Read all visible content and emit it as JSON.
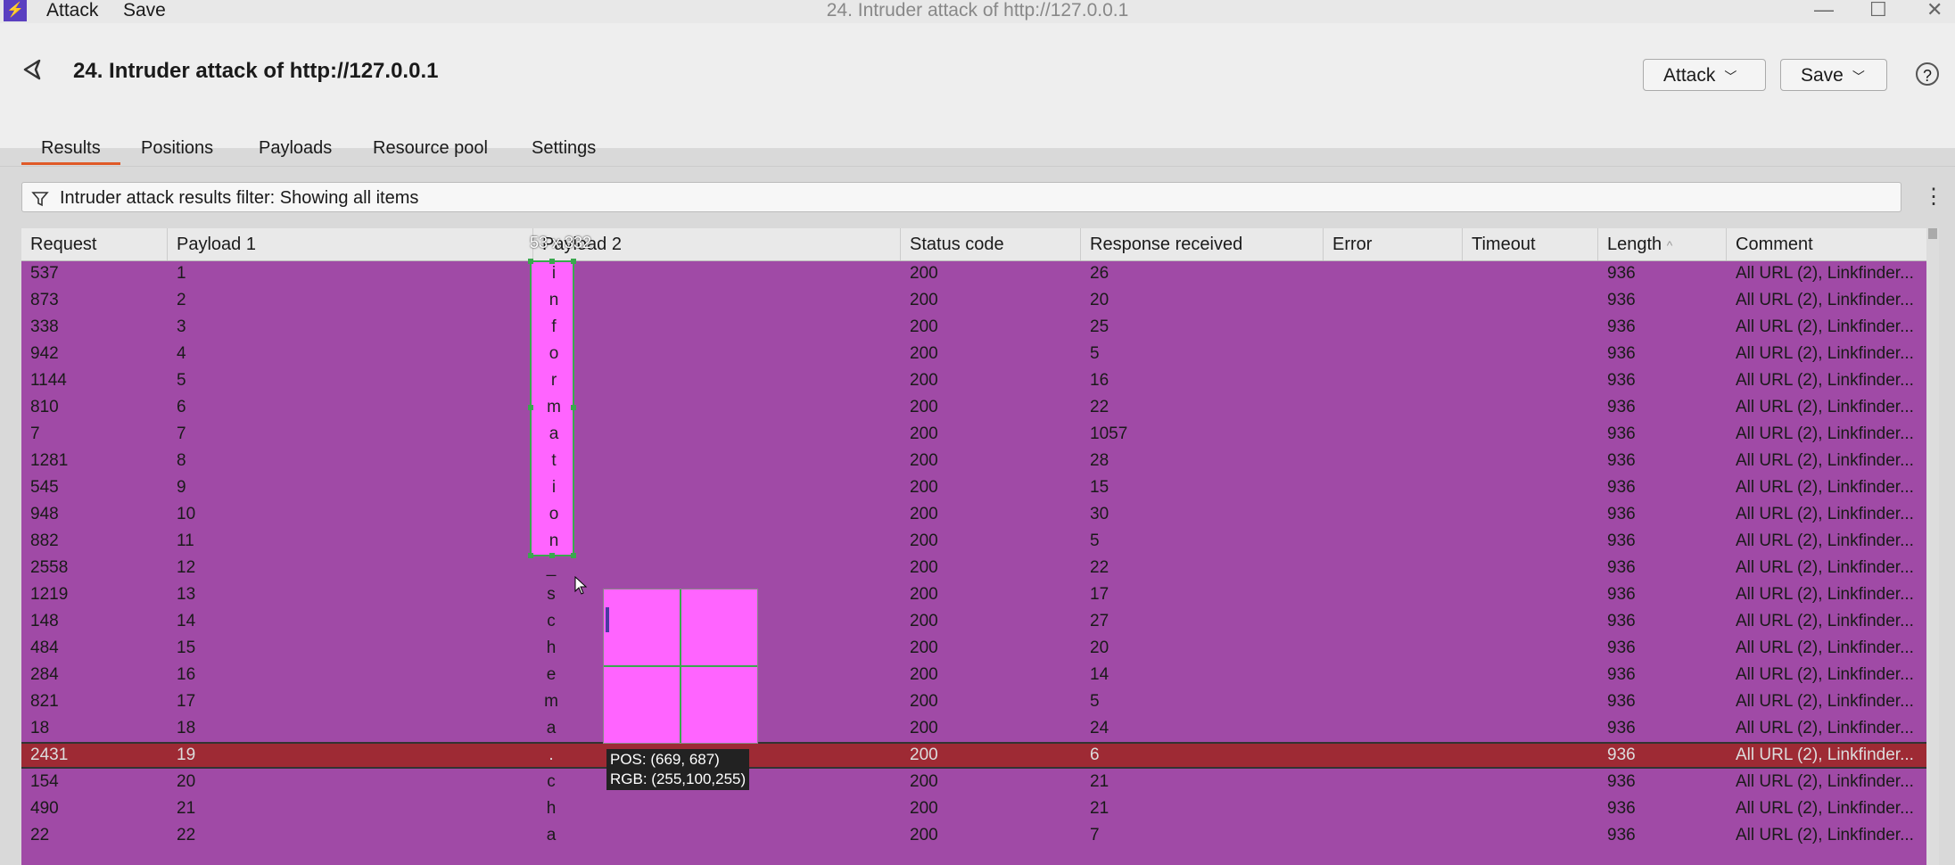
{
  "window": {
    "title": "24. Intruder attack of http://127.0.0.1",
    "menu": [
      "Attack",
      "Save"
    ],
    "controls": [
      "—",
      "☐",
      "✕"
    ]
  },
  "header": {
    "title": "24. Intruder attack of http://127.0.0.1",
    "attack_button": "Attack",
    "save_button": "Save",
    "help": "?"
  },
  "tabs": [
    {
      "label": "Results",
      "active": true
    },
    {
      "label": "Positions"
    },
    {
      "label": "Payloads"
    },
    {
      "label": "Resource pool"
    },
    {
      "label": "Settings"
    }
  ],
  "filter": {
    "text": "Intruder attack results filter: Showing all items"
  },
  "table": {
    "columns": [
      "Request",
      "Payload 1",
      "Payload 2",
      "Status code",
      "Response received",
      "Error",
      "Timeout",
      "Length",
      "Comment"
    ],
    "sort_indicator": "^",
    "rows": [
      {
        "request": "537",
        "p1": "1",
        "p2": "i",
        "status": "200",
        "resp": "26",
        "length": "936",
        "comment": "All URL (2), Linkfinder..."
      },
      {
        "request": "873",
        "p1": "2",
        "p2": "n",
        "status": "200",
        "resp": "20",
        "length": "936",
        "comment": "All URL (2), Linkfinder..."
      },
      {
        "request": "338",
        "p1": "3",
        "p2": "f",
        "status": "200",
        "resp": "25",
        "length": "936",
        "comment": "All URL (2), Linkfinder..."
      },
      {
        "request": "942",
        "p1": "4",
        "p2": "o",
        "status": "200",
        "resp": "5",
        "length": "936",
        "comment": "All URL (2), Linkfinder..."
      },
      {
        "request": "1144",
        "p1": "5",
        "p2": "r",
        "status": "200",
        "resp": "16",
        "length": "936",
        "comment": "All URL (2), Linkfinder..."
      },
      {
        "request": "810",
        "p1": "6",
        "p2": "m",
        "status": "200",
        "resp": "22",
        "length": "936",
        "comment": "All URL (2), Linkfinder..."
      },
      {
        "request": "7",
        "p1": "7",
        "p2": "a",
        "status": "200",
        "resp": "1057",
        "length": "936",
        "comment": "All URL (2), Linkfinder..."
      },
      {
        "request": "1281",
        "p1": "8",
        "p2": "t",
        "status": "200",
        "resp": "28",
        "length": "936",
        "comment": "All URL (2), Linkfinder..."
      },
      {
        "request": "545",
        "p1": "9",
        "p2": "i",
        "status": "200",
        "resp": "15",
        "length": "936",
        "comment": "All URL (2), Linkfinder..."
      },
      {
        "request": "948",
        "p1": "10",
        "p2": "o",
        "status": "200",
        "resp": "30",
        "length": "936",
        "comment": "All URL (2), Linkfinder..."
      },
      {
        "request": "882",
        "p1": "11",
        "p2": "n",
        "status": "200",
        "resp": "5",
        "length": "936",
        "comment": "All URL (2), Linkfinder..."
      },
      {
        "request": "2558",
        "p1": "12",
        "p2": "_",
        "status": "200",
        "resp": "22",
        "length": "936",
        "comment": "All URL (2), Linkfinder..."
      },
      {
        "request": "1219",
        "p1": "13",
        "p2": "s",
        "status": "200",
        "resp": "17",
        "length": "936",
        "comment": "All URL (2), Linkfinder..."
      },
      {
        "request": "148",
        "p1": "14",
        "p2": "c",
        "status": "200",
        "resp": "27",
        "length": "936",
        "comment": "All URL (2), Linkfinder..."
      },
      {
        "request": "484",
        "p1": "15",
        "p2": "h",
        "status": "200",
        "resp": "20",
        "length": "936",
        "comment": "All URL (2), Linkfinder..."
      },
      {
        "request": "284",
        "p1": "16",
        "p2": "e",
        "status": "200",
        "resp": "14",
        "length": "936",
        "comment": "All URL (2), Linkfinder..."
      },
      {
        "request": "821",
        "p1": "17",
        "p2": "m",
        "status": "200",
        "resp": "5",
        "length": "936",
        "comment": "All URL (2), Linkfinder..."
      },
      {
        "request": "18",
        "p1": "18",
        "p2": "a",
        "status": "200",
        "resp": "24",
        "length": "936",
        "comment": "All URL (2), Linkfinder..."
      },
      {
        "request": "2431",
        "p1": "19",
        "p2": ".",
        "status": "200",
        "resp": "6",
        "length": "936",
        "comment": "All URL (2), Linkfinder...",
        "selected": true
      },
      {
        "request": "154",
        "p1": "20",
        "p2": "c",
        "status": "200",
        "resp": "21",
        "length": "936",
        "comment": "All URL (2), Linkfinder..."
      },
      {
        "request": "490",
        "p1": "21",
        "p2": "h",
        "status": "200",
        "resp": "21",
        "length": "936",
        "comment": "All URL (2), Linkfinder..."
      },
      {
        "request": "22",
        "p1": "22",
        "p2": "a",
        "status": "200",
        "resp": "7",
        "length": "936",
        "comment": "All URL (2), Linkfinder..."
      }
    ]
  },
  "overlay": {
    "size_label": "53 x 332",
    "pos_label": "POS:  (669, 687)",
    "rgb_label": "RGB:  (255,100,255)"
  },
  "colors": {
    "row_bg": "#a04aa6",
    "selected_row_bg": "#9e2a34",
    "picked": "#ff64ff",
    "tab_accent": "#e05a28"
  }
}
